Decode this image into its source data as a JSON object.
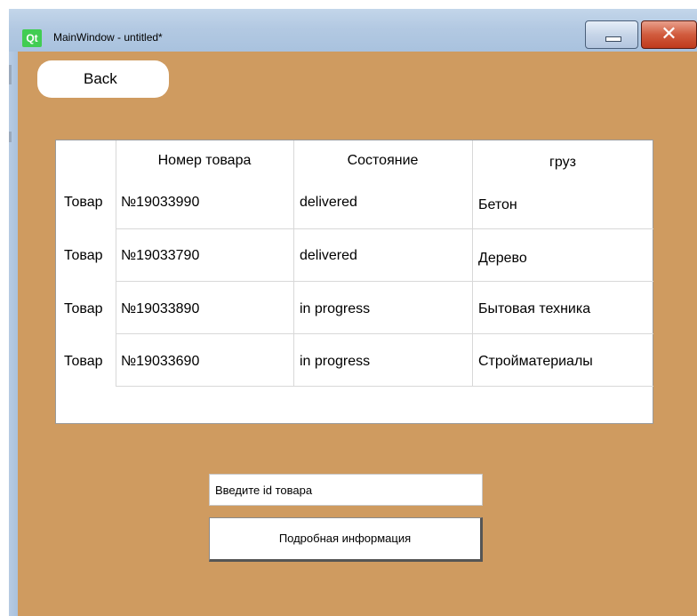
{
  "window": {
    "title": "MainWindow - untitled*",
    "logo_text": "Qt",
    "close_glyph": "✕"
  },
  "back_button": {
    "label": "Back"
  },
  "table": {
    "headers": [
      "Номер товара",
      "Состояние",
      "груз"
    ],
    "rows": [
      {
        "row_label": "Товар",
        "number": "№19033990",
        "state": "delivered",
        "cargo": "Бетон"
      },
      {
        "row_label": "Товар",
        "number": "№19033790",
        "state": "delivered",
        "cargo": "Дерево"
      },
      {
        "row_label": "Товар",
        "number": "№19033890",
        "state": "in progress",
        "cargo": "Бытовая техника"
      },
      {
        "row_label": "Товар",
        "number": "№19033690",
        "state": "in progress",
        "cargo": "Стройматериалы"
      }
    ]
  },
  "id_input": {
    "value": "Введите id товара"
  },
  "info_button": {
    "label": "Подробная информация"
  },
  "colors": {
    "background": "#cf9b60",
    "titlebar": "#b3c9e2",
    "close": "#c8462a"
  }
}
